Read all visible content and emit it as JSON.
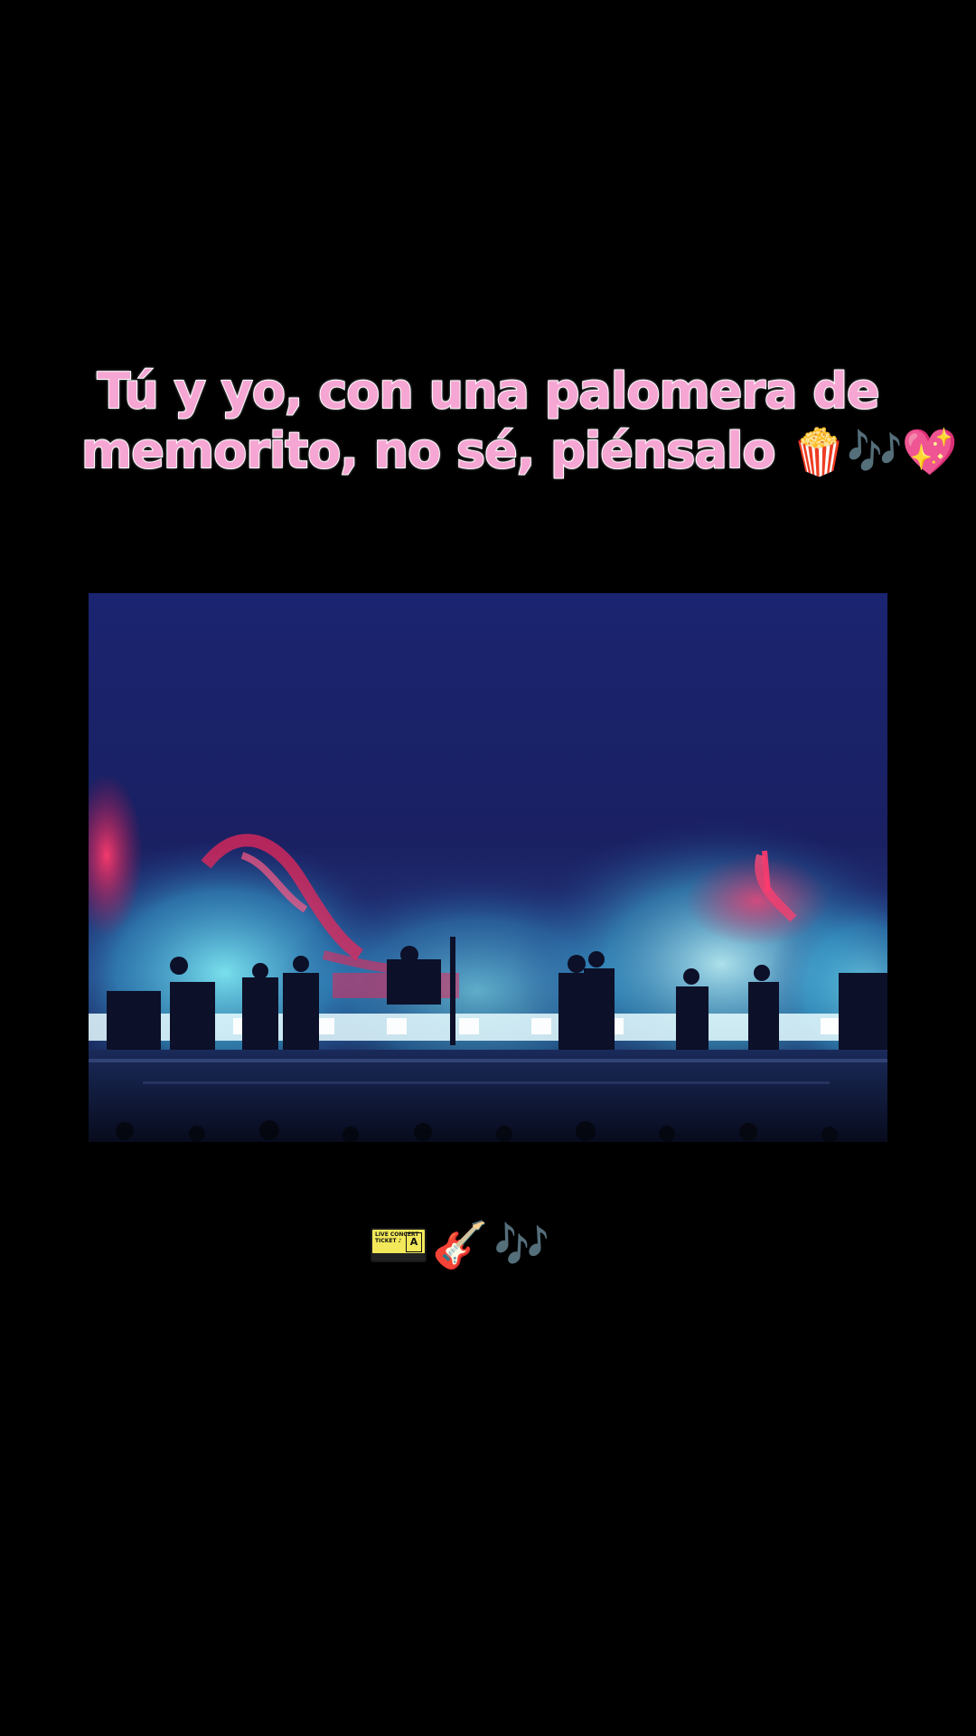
{
  "caption": {
    "line1": "Tú y yo, con una palomera de",
    "line2": "memorito, no sé, piénsalo",
    "line2_emojis": "🍿🎶💖"
  },
  "bottom_emojis": {
    "ticket_text": "LIVE CONCERT TICKET ♪",
    "ticket_zone": "A",
    "guitar": "🎸",
    "notes": "🎶"
  },
  "colors": {
    "background": "#000000",
    "caption_fill": "#f6a6d3",
    "caption_outline": "#ffffff",
    "stage_sky": "#1c2470",
    "stage_smoke": "#3fd0e6",
    "stage_red": "#e8285a"
  }
}
